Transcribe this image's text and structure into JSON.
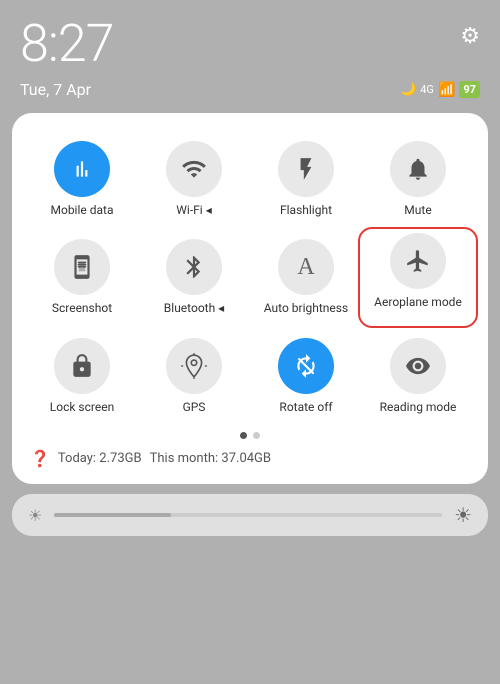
{
  "statusBar": {
    "time": "8:27",
    "date": "Tue, 7 Apr",
    "gearLabel": "⚙",
    "moonIcon": "🌙",
    "signalText": "4G",
    "battery": "97"
  },
  "panel": {
    "tiles": [
      {
        "id": "mobile-data",
        "label": "Mobile data",
        "active": true,
        "icon": "mobile"
      },
      {
        "id": "wifi",
        "label": "Wi-Fi ◂",
        "active": false,
        "icon": "wifi"
      },
      {
        "id": "flashlight",
        "label": "Flashlight",
        "active": false,
        "icon": "flashlight"
      },
      {
        "id": "mute",
        "label": "Mute",
        "active": false,
        "icon": "mute"
      },
      {
        "id": "screenshot",
        "label": "Screenshot",
        "active": false,
        "icon": "screenshot"
      },
      {
        "id": "bluetooth",
        "label": "Bluetooth ◂",
        "active": false,
        "icon": "bluetooth"
      },
      {
        "id": "auto-brightness",
        "label": "Auto brightness",
        "active": false,
        "icon": "text-a"
      },
      {
        "id": "aeroplane-mode",
        "label": "Aeroplane mode",
        "active": false,
        "icon": "aeroplane",
        "highlighted": true
      },
      {
        "id": "lock-screen",
        "label": "Lock screen",
        "active": false,
        "icon": "lock"
      },
      {
        "id": "gps",
        "label": "GPS",
        "active": false,
        "icon": "gps"
      },
      {
        "id": "rotate-off",
        "label": "Rotate off",
        "active": true,
        "icon": "rotate"
      },
      {
        "id": "reading-mode",
        "label": "Reading mode",
        "active": false,
        "icon": "eye"
      }
    ],
    "dots": [
      true,
      false
    ],
    "dataToday": "Today: 2.73GB",
    "dataMonth": "This month: 37.04GB"
  },
  "brightness": {
    "level": 30
  }
}
